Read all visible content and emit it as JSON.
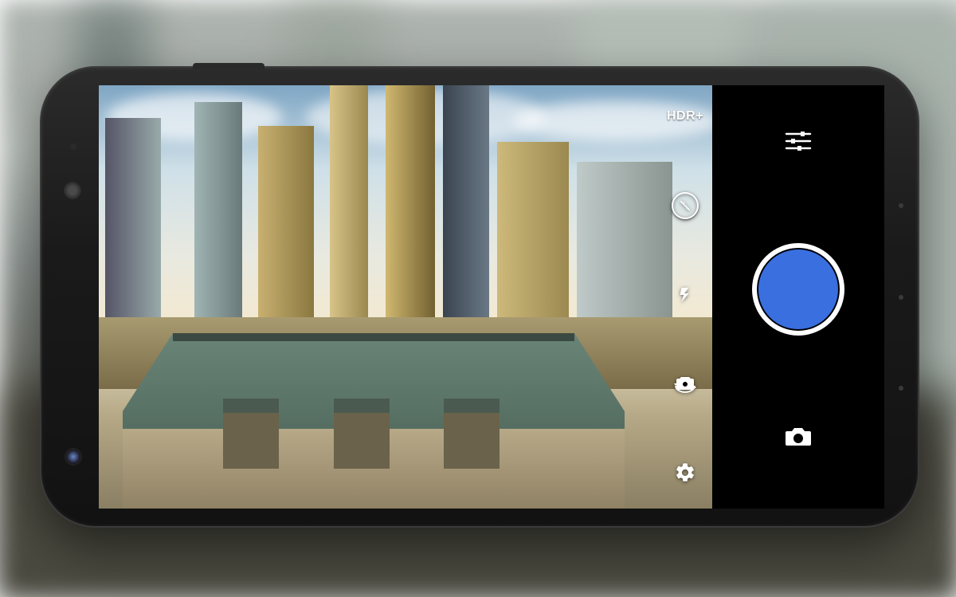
{
  "viewfinder": {
    "hdr_label": "HDR+",
    "icons": {
      "exposure": "exposure-icon",
      "flash": "flash-icon",
      "switch_camera": "switch-camera-icon",
      "settings": "settings-icon"
    }
  },
  "controls": {
    "icons": {
      "options": "sliders-icon",
      "shutter": "shutter-button",
      "mode": "camera-mode-icon"
    },
    "shutter_color": "#3a6fe0"
  }
}
